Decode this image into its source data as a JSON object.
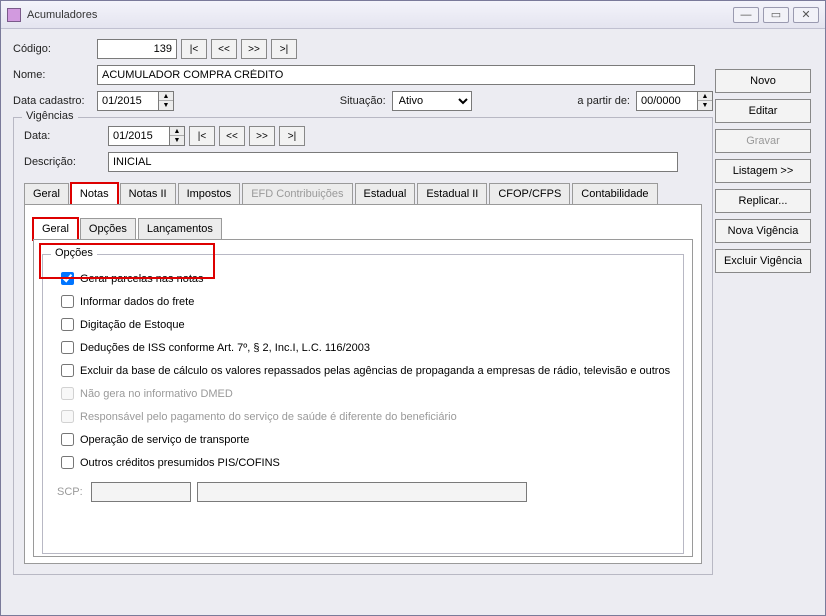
{
  "window": {
    "title": "Acumuladores"
  },
  "header": {
    "codigo_label": "Código:",
    "codigo_value": "139",
    "nome_label": "Nome:",
    "nome_value": "ACUMULADOR COMPRA CRÉDITO",
    "data_cadastro_label": "Data cadastro:",
    "data_cadastro_value": "01/2015",
    "situacao_label": "Situação:",
    "situacao_value": "Ativo",
    "a_partir_de_label": "a partir de:",
    "a_partir_de_value": "00/0000"
  },
  "nav": {
    "first": "|<",
    "prev": "<<",
    "next": ">>",
    "last": ">|"
  },
  "vigencias": {
    "legend": "Vigências",
    "data_label": "Data:",
    "data_value": "01/2015",
    "descricao_label": "Descrição:",
    "descricao_value": "INICIAL"
  },
  "tabs_main": {
    "geral": "Geral",
    "notas": "Notas",
    "notas2": "Notas II",
    "impostos": "Impostos",
    "efd": "EFD Contribuições",
    "estadual": "Estadual",
    "estadual2": "Estadual II",
    "cfop": "CFOP/CFPS",
    "contab": "Contabilidade"
  },
  "tabs_sub": {
    "geral": "Geral",
    "opcoes": "Opções",
    "lancamentos": "Lançamentos"
  },
  "opcoes": {
    "legend": "Opções",
    "gerar_parcelas": "Gerar parcelas nas notas",
    "informar_frete": "Informar dados do frete",
    "digitacao_estoque": "Digitação de Estoque",
    "deducoes_iss": "Deduções de ISS conforme Art. 7º, § 2, Inc.I, L.C. 116/2003",
    "excluir_base": "Excluir da base de cálculo os valores repassados pelas agências de propaganda a empresas de rádio, televisão e outros",
    "nao_gera_dmed": "Não gera no informativo DMED",
    "responsavel_saude": "Responsável pelo pagamento do serviço de saúde é diferente do beneficiário",
    "operacao_transporte": "Operação de serviço de transporte",
    "outros_creditos": "Outros créditos presumidos PIS/COFINS",
    "scp_label": "SCP:"
  },
  "buttons": {
    "novo": "Novo",
    "editar": "Editar",
    "gravar": "Gravar",
    "listagem": "Listagem >>",
    "replicar": "Replicar...",
    "nova_vigencia": "Nova Vigência",
    "excluir_vigencia": "Excluir Vigência"
  }
}
